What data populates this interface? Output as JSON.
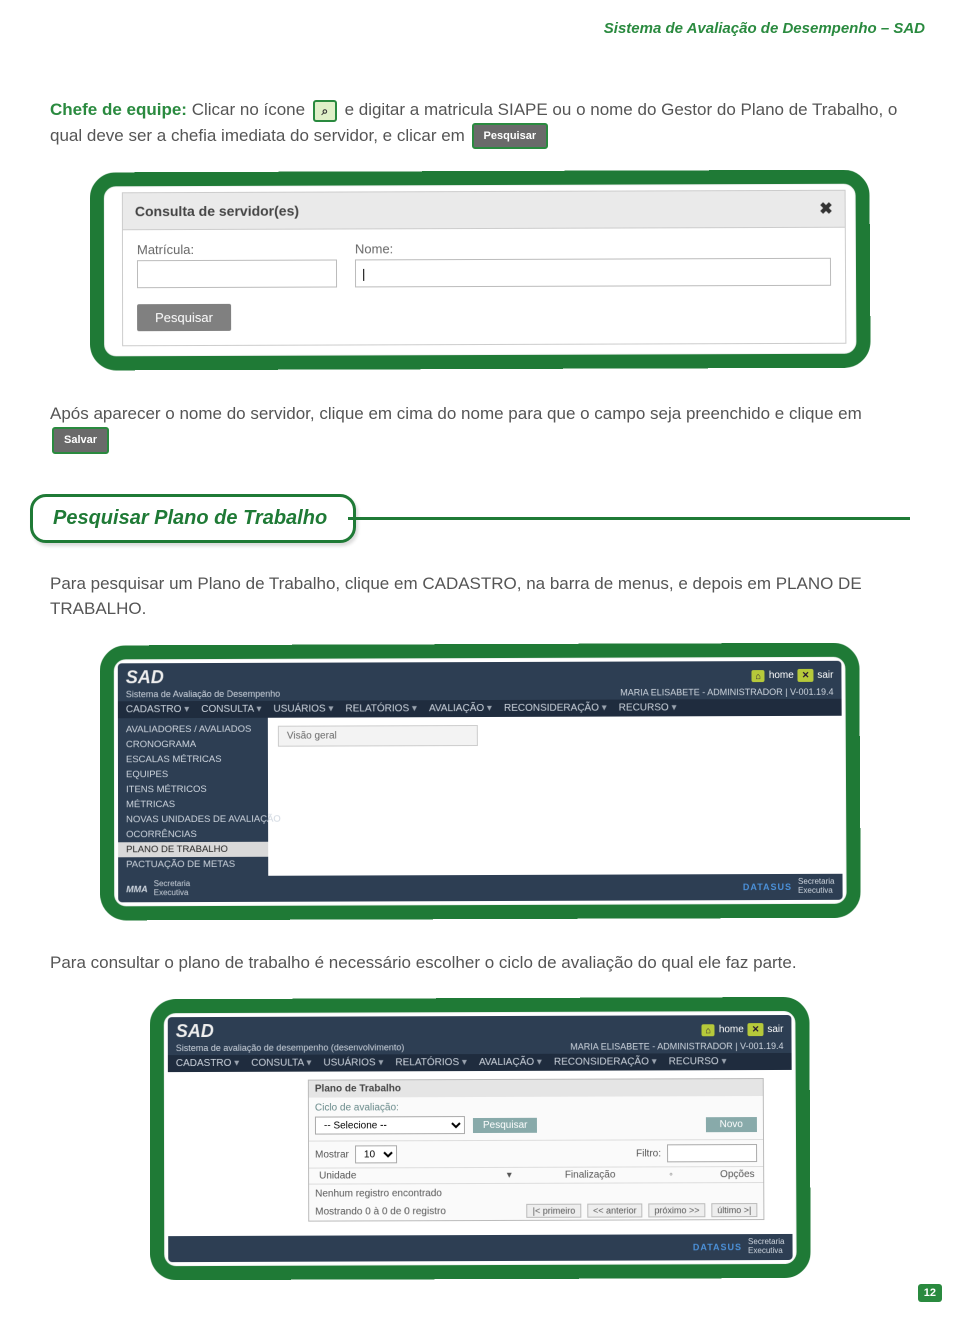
{
  "header": {
    "system_name": "Sistema de Avaliação de Desempenho – SAD"
  },
  "page_number": "12",
  "intro": {
    "lead": "Chefe de equipe:",
    "part1": " Clicar no ícone ",
    "icon_glyph": "⌕",
    "part2": " e digitar a matricula SIAPE ou o nome do Gestor do Plano de Trabalho, o qual deve ser a chefia imediata do servidor, e clicar em ",
    "btn": "Pesquisar"
  },
  "dialog": {
    "title": "Consulta de servidor(es)",
    "field_matricula_label": "Matrícula:",
    "field_nome_label": "Nome:",
    "btn_pesquisar": "Pesquisar"
  },
  "after_search": {
    "part1": "Após aparecer o nome do servidor, clique em cima do nome para que o campo seja preenchido e clique em ",
    "btn": "Salvar"
  },
  "section_heading": "Pesquisar Plano de Trabalho",
  "section_text": "Para pesquisar um Plano de Trabalho, clique em CADASTRO, na barra de menus, e depois em PLANO DE TRABALHO.",
  "app": {
    "logo": "SAD",
    "subtitle_full": "Sistema de Avaliação de Desempenho",
    "subtitle_dev": "Sistema de avaliação de desempenho (desenvolvimento)",
    "home": "home",
    "sair": "sair",
    "user_line": "MARIA ELISABETE - ADMINISTRADOR | V-001.19.4",
    "menu": [
      "CADASTRO",
      "CONSULTA",
      "USUÁRIOS",
      "RELATÓRIOS",
      "AVALIAÇÃO",
      "RECONSIDERAÇÃO",
      "RECURSO"
    ],
    "sidebar": [
      "AVALIADORES / AVALIADOS",
      "CRONOGRAMA",
      "ESCALAS MÉTRICAS",
      "EQUIPES",
      "ITENS MÉTRICOS",
      "MÉTRICAS",
      "NOVAS UNIDADES DE AVALIAÇÃO",
      "OCORRÊNCIAS",
      "PLANO DE TRABALHO",
      "PACTUAÇÃO DE METAS"
    ],
    "sidebar_selected_index": 8,
    "visao_geral": "Visão geral",
    "footer_left": "MMA",
    "footer_left_sub1": "Secretaria",
    "footer_left_sub2": "Executiva",
    "footer_right_brand": "DATASUS",
    "footer_right_sub1": "Secretaria",
    "footer_right_sub2": "Executiva"
  },
  "bottom_text": "Para consultar o plano de trabalho é necessário escolher o ciclo de avaliação do qual ele faz parte.",
  "panel3": {
    "title": "Plano de Trabalho",
    "ciclo_label": "Ciclo de avaliação:",
    "ciclo_placeholder": "-- Selecione --",
    "btn_pesquisar": "Pesquisar",
    "btn_novo": "Novo",
    "mostrar_label": "Mostrar",
    "mostrar_value": "10",
    "filtro_label": "Filtro:",
    "col_unidade": "Unidade",
    "col_finalizacao": "Finalização",
    "col_opcoes": "Opções",
    "no_records": "Nenhum registro encontrado",
    "showing": "Mostrando 0 à 0 de 0 registro",
    "pg_first": "|< primeiro",
    "pg_prev": "<< anterior",
    "pg_next": "próximo >>",
    "pg_last": "último >|"
  }
}
